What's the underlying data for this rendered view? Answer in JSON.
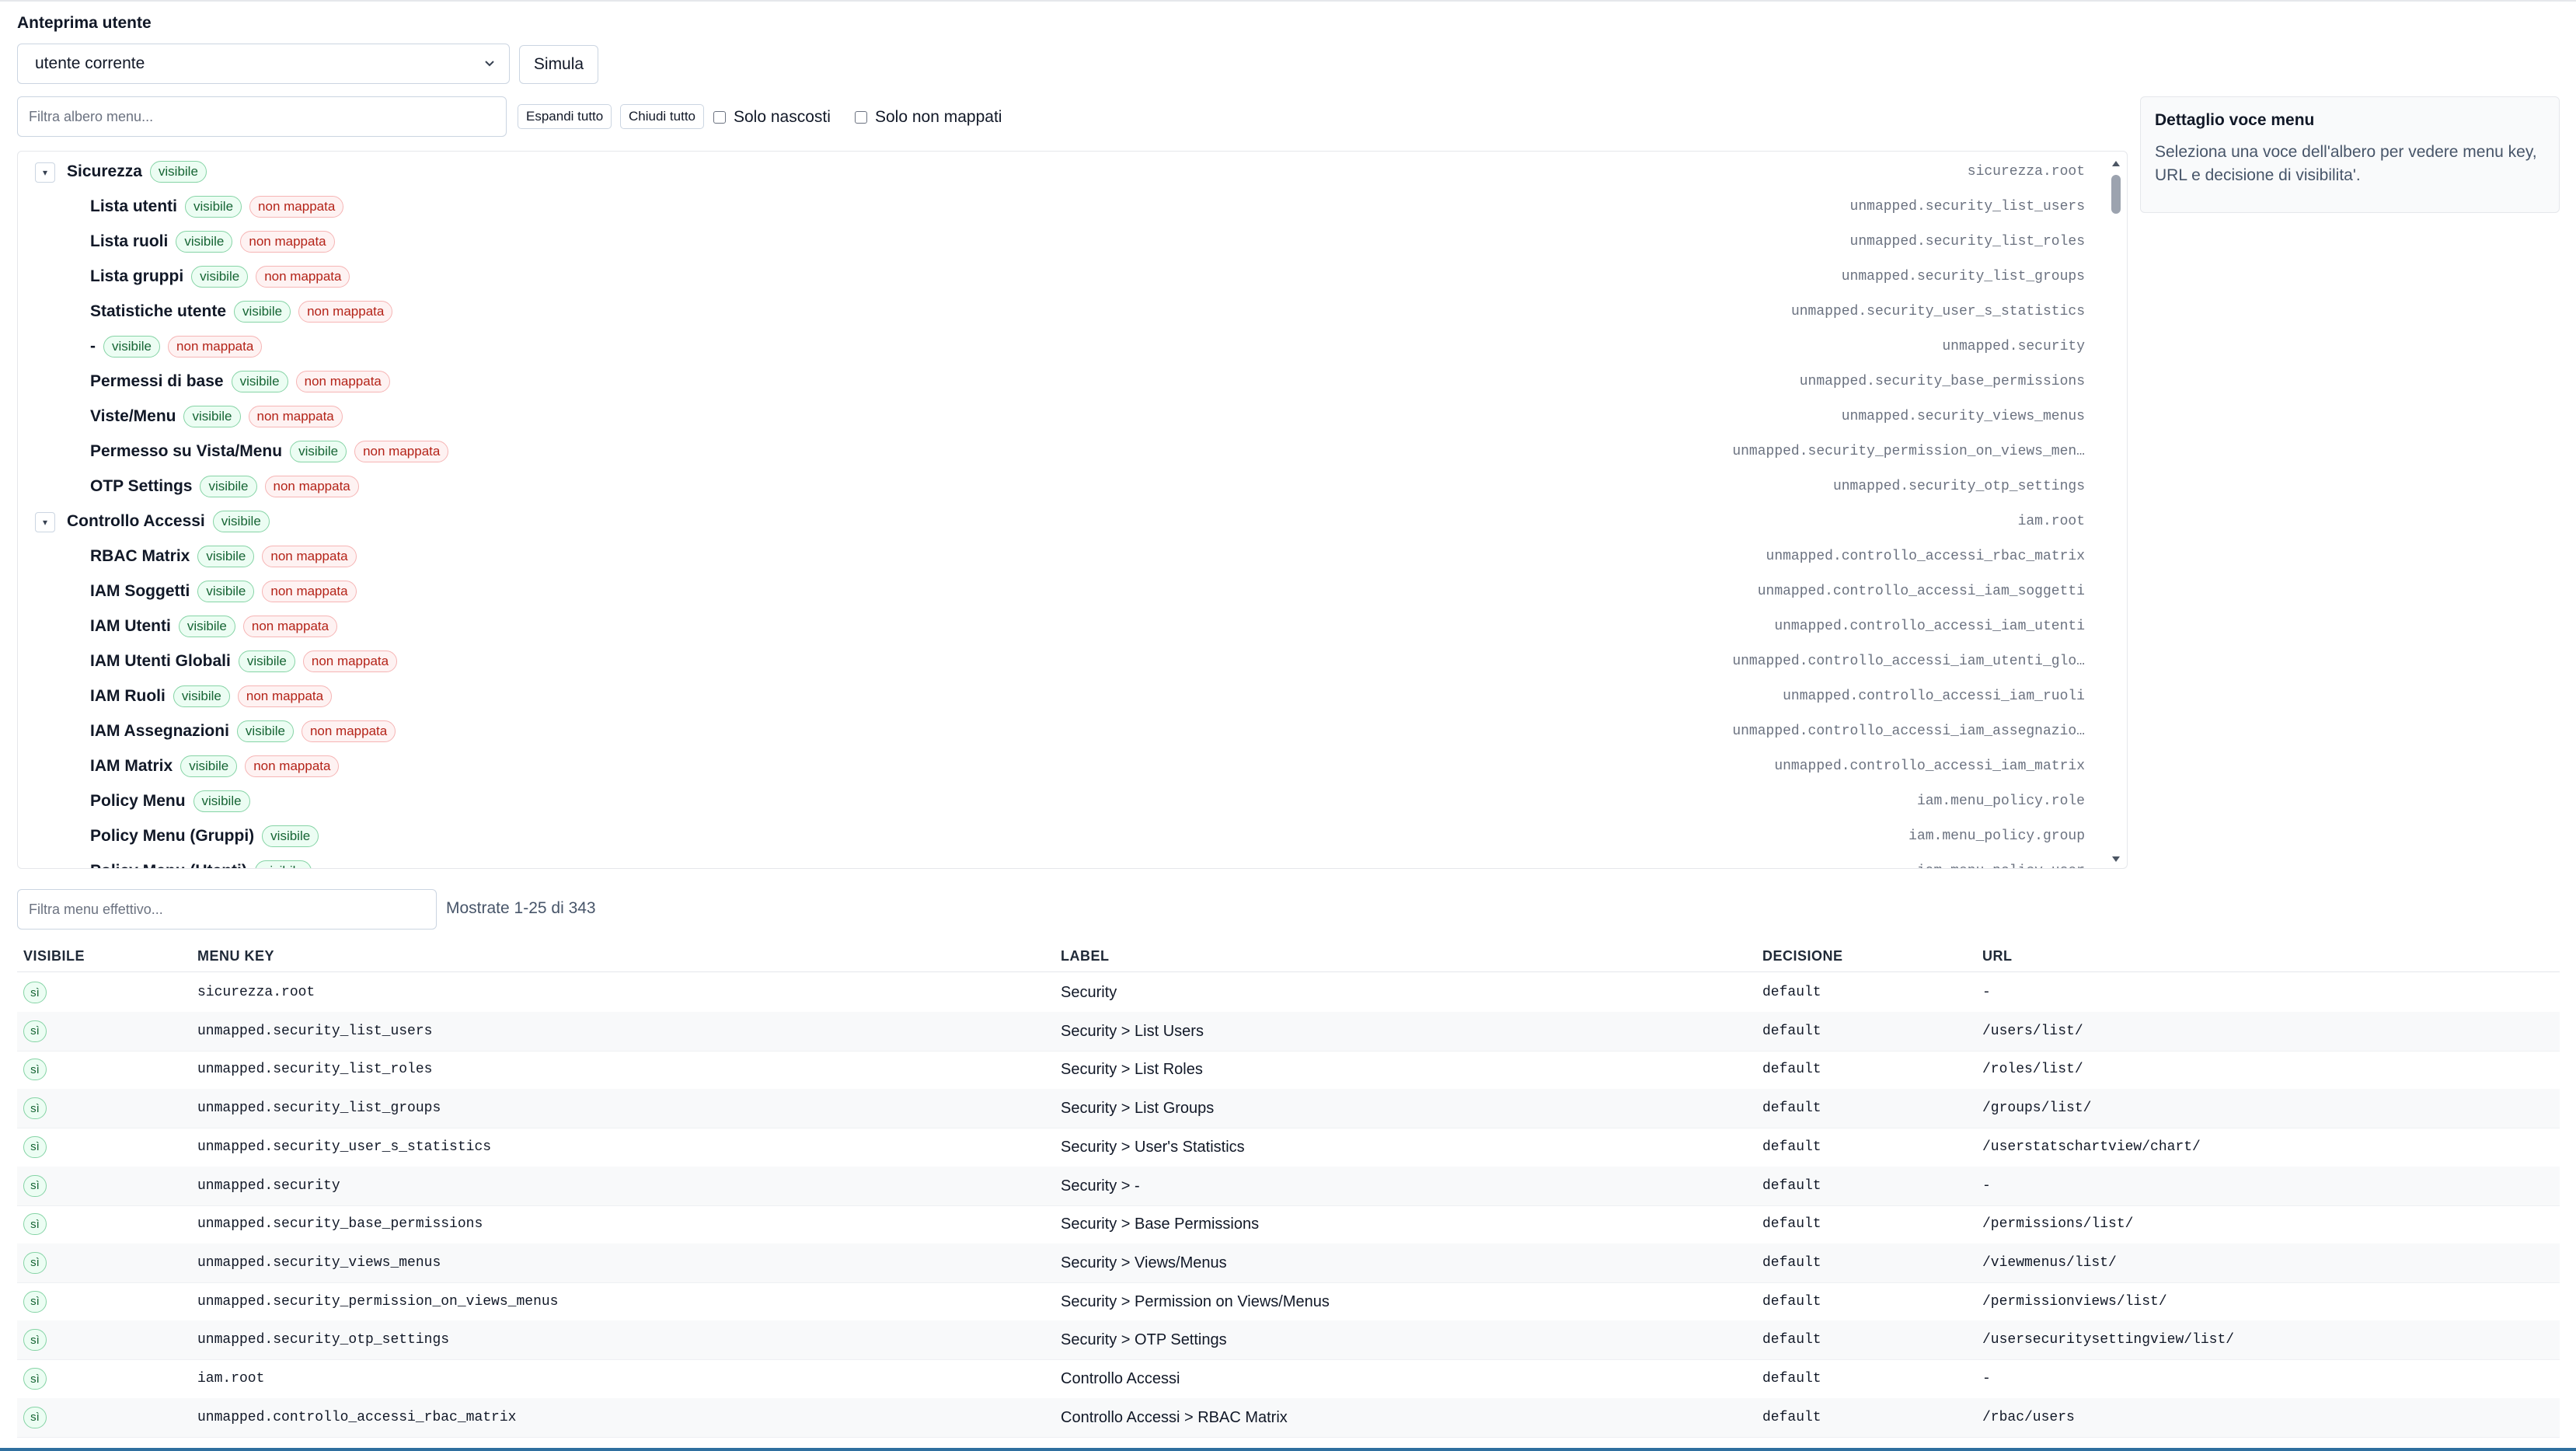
{
  "header": {
    "title": "Anteprima utente"
  },
  "user_select": {
    "value": "utente corrente"
  },
  "simulate_button": "Simula",
  "tree_filter": {
    "placeholder": "Filtra albero menu..."
  },
  "tree_controls": {
    "expand_all": "Espandi tutto",
    "collapse_all": "Chiudi tutto",
    "only_hidden": "Solo nascosti",
    "only_unmapped": "Solo non mappati"
  },
  "tree": {
    "rows": [
      {
        "label": "Sicurezza",
        "level": 0,
        "visible": "visibile",
        "unmapped": "",
        "key": "sicurezza.root"
      },
      {
        "label": "Lista utenti",
        "level": 1,
        "visible": "visibile",
        "unmapped": "non mappata",
        "key": "unmapped.security_list_users"
      },
      {
        "label": "Lista ruoli",
        "level": 1,
        "visible": "visibile",
        "unmapped": "non mappata",
        "key": "unmapped.security_list_roles"
      },
      {
        "label": "Lista gruppi",
        "level": 1,
        "visible": "visibile",
        "unmapped": "non mappata",
        "key": "unmapped.security_list_groups"
      },
      {
        "label": "Statistiche utente",
        "level": 1,
        "visible": "visibile",
        "unmapped": "non mappata",
        "key": "unmapped.security_user_s_statistics"
      },
      {
        "label": "-",
        "level": 1,
        "visible": "visibile",
        "unmapped": "non mappata",
        "key": "unmapped.security"
      },
      {
        "label": "Permessi di base",
        "level": 1,
        "visible": "visibile",
        "unmapped": "non mappata",
        "key": "unmapped.security_base_permissions"
      },
      {
        "label": "Viste/Menu",
        "level": 1,
        "visible": "visibile",
        "unmapped": "non mappata",
        "key": "unmapped.security_views_menus"
      },
      {
        "label": "Permesso su Vista/Menu",
        "level": 1,
        "visible": "visibile",
        "unmapped": "non mappata",
        "key": "unmapped.security_permission_on_views_men…"
      },
      {
        "label": "OTP Settings",
        "level": 1,
        "visible": "visibile",
        "unmapped": "non mappata",
        "key": "unmapped.security_otp_settings"
      },
      {
        "label": "Controllo Accessi",
        "level": 0,
        "visible": "visibile",
        "unmapped": "",
        "key": "iam.root"
      },
      {
        "label": "RBAC Matrix",
        "level": 1,
        "visible": "visibile",
        "unmapped": "non mappata",
        "key": "unmapped.controllo_accessi_rbac_matrix"
      },
      {
        "label": "IAM Soggetti",
        "level": 1,
        "visible": "visibile",
        "unmapped": "non mappata",
        "key": "unmapped.controllo_accessi_iam_soggetti"
      },
      {
        "label": "IAM Utenti",
        "level": 1,
        "visible": "visibile",
        "unmapped": "non mappata",
        "key": "unmapped.controllo_accessi_iam_utenti"
      },
      {
        "label": "IAM Utenti Globali",
        "level": 1,
        "visible": "visibile",
        "unmapped": "non mappata",
        "key": "unmapped.controllo_accessi_iam_utenti_glo…"
      },
      {
        "label": "IAM Ruoli",
        "level": 1,
        "visible": "visibile",
        "unmapped": "non mappata",
        "key": "unmapped.controllo_accessi_iam_ruoli"
      },
      {
        "label": "IAM Assegnazioni",
        "level": 1,
        "visible": "visibile",
        "unmapped": "non mappata",
        "key": "unmapped.controllo_accessi_iam_assegnazio…"
      },
      {
        "label": "IAM Matrix",
        "level": 1,
        "visible": "visibile",
        "unmapped": "non mappata",
        "key": "unmapped.controllo_accessi_iam_matrix"
      },
      {
        "label": "Policy Menu",
        "level": 1,
        "visible": "visibile",
        "unmapped": "",
        "key": "iam.menu_policy.role"
      },
      {
        "label": "Policy Menu (Gruppi)",
        "level": 1,
        "visible": "visibile",
        "unmapped": "",
        "key": "iam.menu_policy.group"
      },
      {
        "label": "Policy Menu (Utenti)",
        "level": 1,
        "visible": "visibile",
        "unmapped": "",
        "key": "iam.menu_policy.user"
      }
    ]
  },
  "detail_panel": {
    "title": "Dettaglio voce menu",
    "body": "Seleziona una voce dell'albero per vedere menu key, URL e decisione di visibilita'."
  },
  "effective_filter": {
    "placeholder": "Filtra menu effettivo..."
  },
  "pagination": {
    "shown": "Mostrate 1-25 di 343"
  },
  "table": {
    "headers": [
      "VISIBILE",
      "MENU KEY",
      "LABEL",
      "DECISIONE",
      "URL"
    ],
    "rows": [
      {
        "visible": "sì",
        "key": "sicurezza.root",
        "label": "Security",
        "decision": "default",
        "url": "-"
      },
      {
        "visible": "sì",
        "key": "unmapped.security_list_users",
        "label": "Security > List Users",
        "decision": "default",
        "url": "/users/list/"
      },
      {
        "visible": "sì",
        "key": "unmapped.security_list_roles",
        "label": "Security > List Roles",
        "decision": "default",
        "url": "/roles/list/"
      },
      {
        "visible": "sì",
        "key": "unmapped.security_list_groups",
        "label": "Security > List Groups",
        "decision": "default",
        "url": "/groups/list/"
      },
      {
        "visible": "sì",
        "key": "unmapped.security_user_s_statistics",
        "label": "Security > User's Statistics",
        "decision": "default",
        "url": "/userstatschartview/chart/"
      },
      {
        "visible": "sì",
        "key": "unmapped.security",
        "label": "Security > -",
        "decision": "default",
        "url": "-"
      },
      {
        "visible": "sì",
        "key": "unmapped.security_base_permissions",
        "label": "Security > Base Permissions",
        "decision": "default",
        "url": "/permissions/list/"
      },
      {
        "visible": "sì",
        "key": "unmapped.security_views_menus",
        "label": "Security > Views/Menus",
        "decision": "default",
        "url": "/viewmenus/list/"
      },
      {
        "visible": "sì",
        "key": "unmapped.security_permission_on_views_menus",
        "label": "Security > Permission on Views/Menus",
        "decision": "default",
        "url": "/permissionviews/list/"
      },
      {
        "visible": "sì",
        "key": "unmapped.security_otp_settings",
        "label": "Security > OTP Settings",
        "decision": "default",
        "url": "/usersecuritysettingview/list/"
      },
      {
        "visible": "sì",
        "key": "iam.root",
        "label": "Controllo Accessi",
        "decision": "default",
        "url": "-"
      },
      {
        "visible": "sì",
        "key": "unmapped.controllo_accessi_rbac_matrix",
        "label": "Controllo Accessi > RBAC Matrix",
        "decision": "default",
        "url": "/rbac/users"
      }
    ]
  }
}
